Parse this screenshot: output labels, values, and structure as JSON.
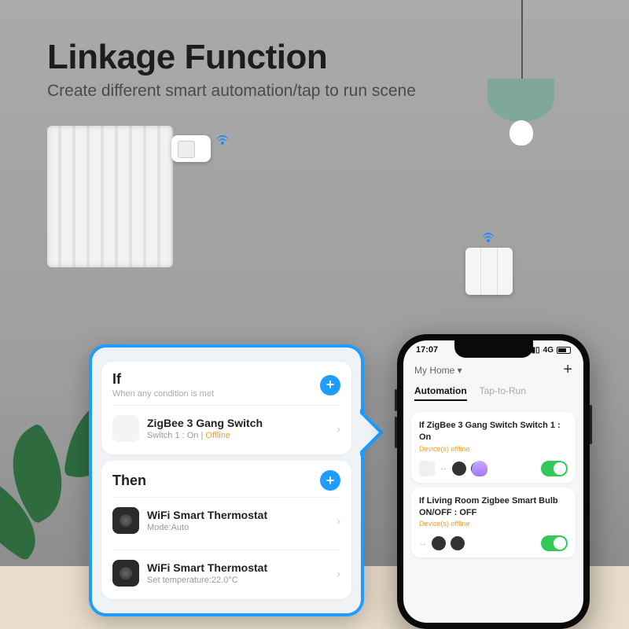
{
  "heading": {
    "title": "Linkage Function",
    "subtitle": "Create different smart automation/tap to run scene"
  },
  "popup": {
    "if": {
      "title": "If",
      "subtitle": "When any condition is met",
      "items": [
        {
          "name": "ZigBee 3 Gang Switch",
          "detail_prefix": "Switch 1 : On  |  ",
          "status": "Offline"
        }
      ]
    },
    "then": {
      "title": "Then",
      "items": [
        {
          "name": "WiFi Smart Thermostat",
          "detail": "Mode:Auto"
        },
        {
          "name": "WiFi Smart Thermostat",
          "detail": "Set temperature:22.0°C"
        }
      ]
    }
  },
  "phone": {
    "status": {
      "time": "17:07",
      "network": "4G"
    },
    "home_label": "My Home ▾",
    "tabs": {
      "automation": "Automation",
      "tap": "Tap-to-Run"
    },
    "cards": [
      {
        "title": "If ZigBee 3 Gang Switch Switch 1 : On",
        "status": "Device(s) offline"
      },
      {
        "title": "If  Living Room Zigbee Smart Bulb ON/OFF : OFF",
        "status": "Device(s) offline"
      }
    ]
  },
  "glyphs": {
    "plus": "+",
    "chevron": "›",
    "nav": "➤",
    "arrow": "↔",
    "dots": "•••"
  }
}
